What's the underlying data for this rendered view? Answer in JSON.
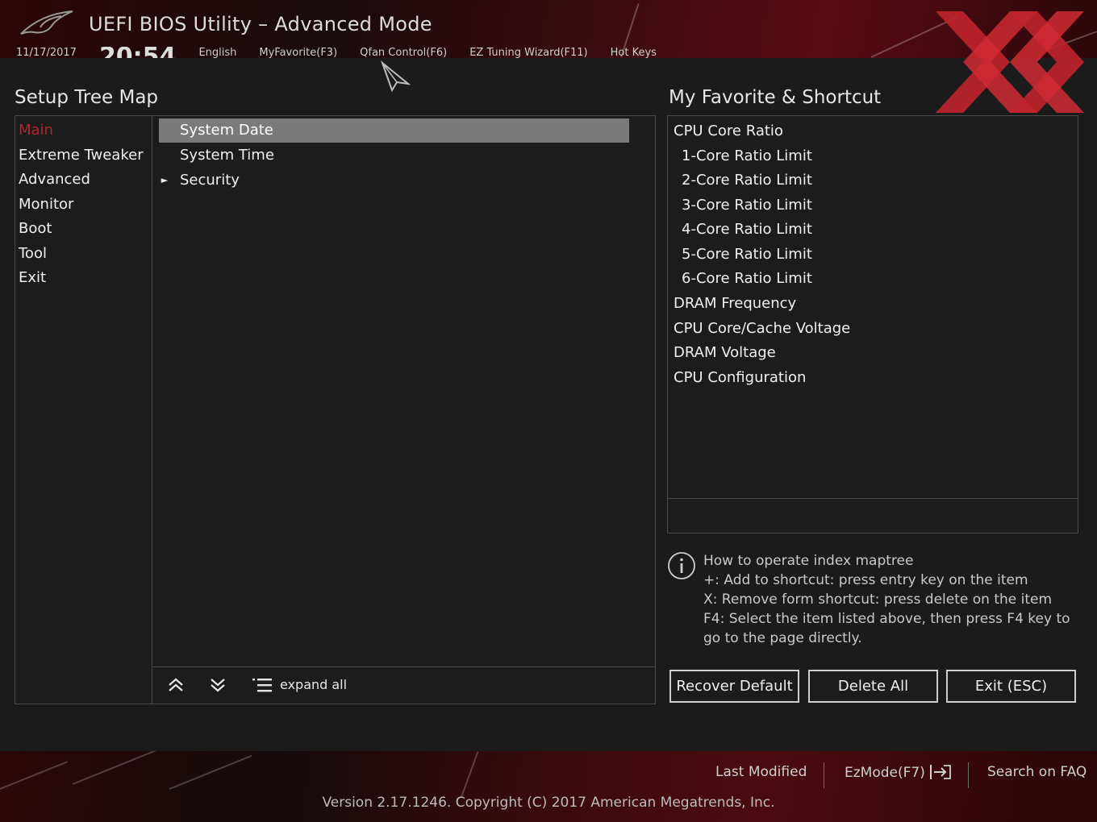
{
  "header": {
    "title": "UEFI BIOS Utility – Advanced Mode",
    "date": "11/17/2017",
    "time": "20:54",
    "toolbar": {
      "language": "English",
      "my_favorite": "MyFavorite(F3)",
      "qfan": "Qfan Control(F6)",
      "ez_tuning": "EZ Tuning Wizard(F11)",
      "hot_keys": "Hot Keys"
    }
  },
  "left_panel": {
    "title": "Setup Tree Map",
    "categories": [
      {
        "label": "Main",
        "active": true
      },
      {
        "label": "Extreme Tweaker",
        "active": false
      },
      {
        "label": "Advanced",
        "active": false
      },
      {
        "label": "Monitor",
        "active": false
      },
      {
        "label": "Boot",
        "active": false
      },
      {
        "label": "Tool",
        "active": false
      },
      {
        "label": "Exit",
        "active": false
      }
    ],
    "items": [
      {
        "label": "System Date",
        "selected": true,
        "expandable": false
      },
      {
        "label": "System Time",
        "selected": false,
        "expandable": false
      },
      {
        "label": "Security",
        "selected": false,
        "expandable": true
      }
    ],
    "toolbar": {
      "expand_all": "expand all"
    }
  },
  "right_panel": {
    "title": "My Favorite & Shortcut",
    "items": [
      {
        "label": "CPU Core Ratio",
        "indent": 0
      },
      {
        "label": "1-Core Ratio Limit",
        "indent": 1
      },
      {
        "label": "2-Core Ratio Limit",
        "indent": 1
      },
      {
        "label": "3-Core Ratio Limit",
        "indent": 1
      },
      {
        "label": "4-Core Ratio Limit",
        "indent": 1
      },
      {
        "label": "5-Core Ratio Limit",
        "indent": 1
      },
      {
        "label": "6-Core Ratio Limit",
        "indent": 1
      },
      {
        "label": "DRAM Frequency",
        "indent": 0
      },
      {
        "label": "CPU Core/Cache Voltage",
        "indent": 0
      },
      {
        "label": "DRAM Voltage",
        "indent": 0
      },
      {
        "label": "CPU Configuration",
        "indent": 0
      }
    ],
    "help": {
      "lines": [
        "How to operate index maptree",
        "+: Add to shortcut: press entry key on the item",
        "X: Remove form shortcut: press delete on the item",
        "F4: Select the item listed above, then press F4 key to",
        "go to the page directly."
      ]
    },
    "buttons": {
      "recover_default": "Recover Default",
      "delete_all": "Delete All",
      "exit": "Exit (ESC)"
    }
  },
  "footer": {
    "last_modified": "Last Modified",
    "ez_mode": "EzMode(F7)",
    "search_faq": "Search on FAQ",
    "version": "Version 2.17.1246. Copyright (C) 2017 American Megatrends, Inc."
  },
  "colors": {
    "accent_red": "#b3262e",
    "selected_row": "#7a7a7a",
    "border": "#4a4a4a",
    "background": "#1b1b1b"
  }
}
